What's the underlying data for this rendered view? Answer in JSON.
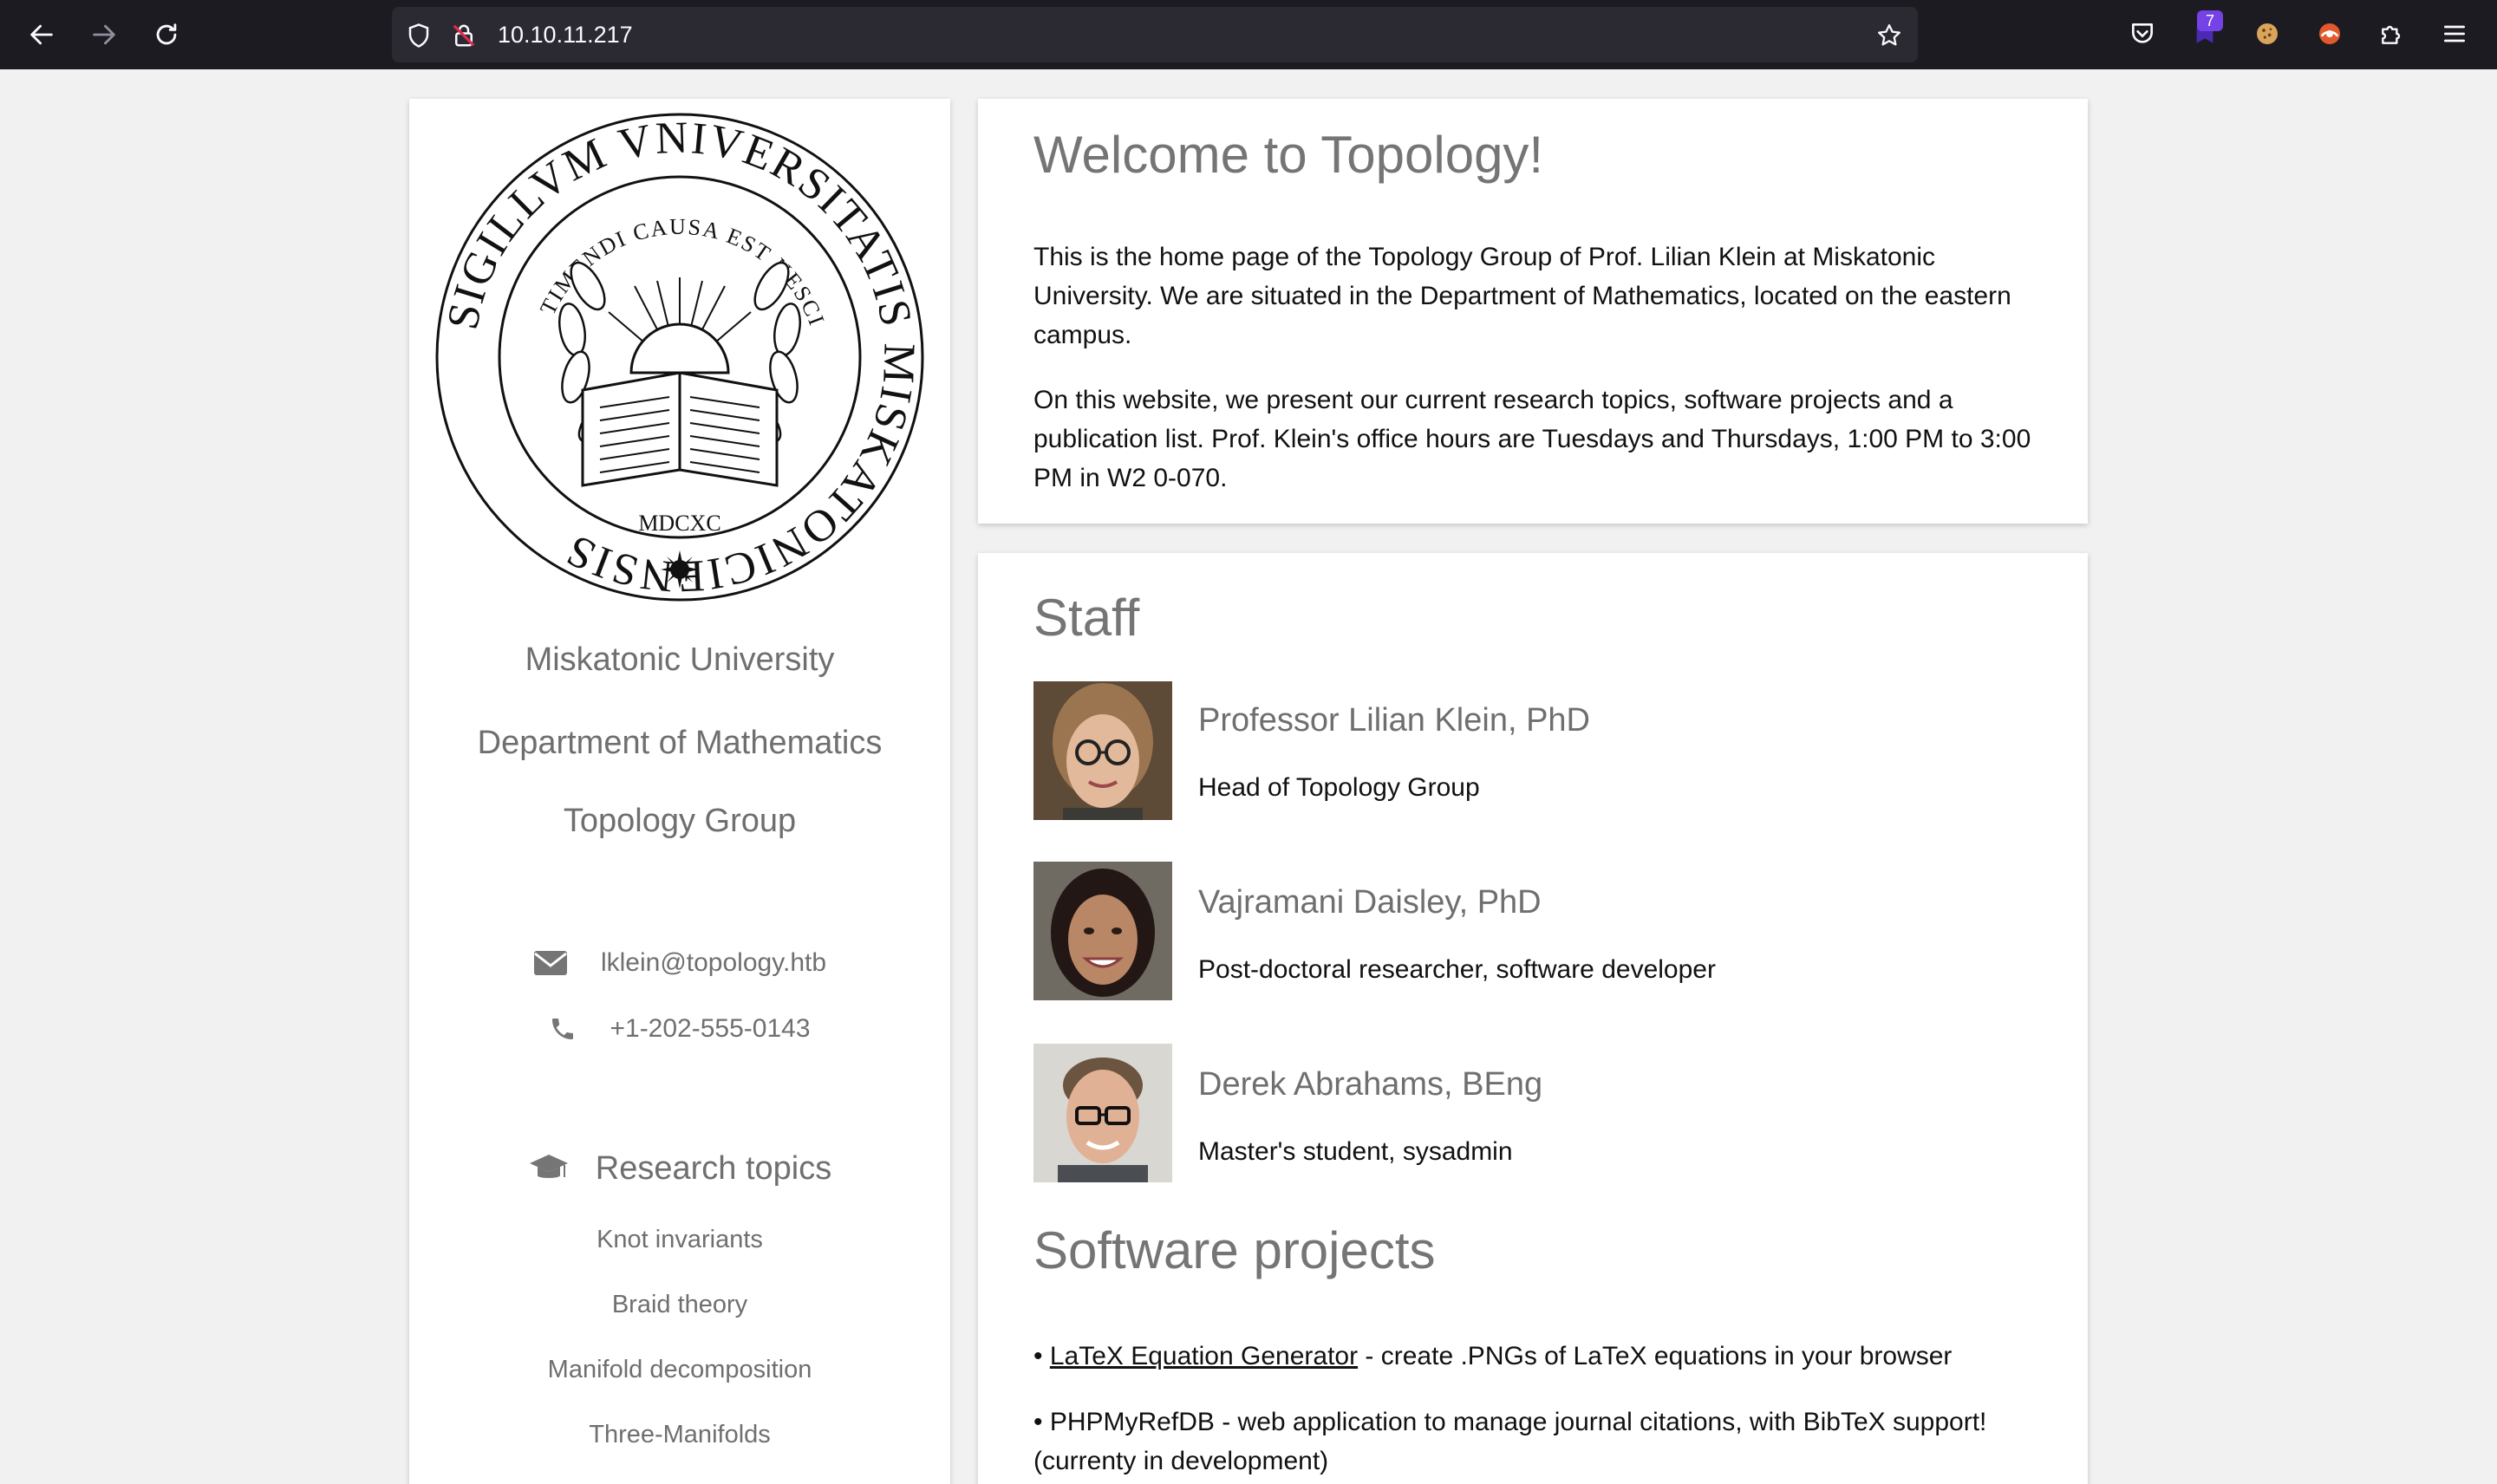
{
  "browser": {
    "url": "10.10.11.217",
    "extension_badge": "7"
  },
  "sidebar": {
    "seal_text_outer": "SIGILLVM VNIVERSITATIS MISKATONICIENSIS",
    "seal_text_inner": "TIMENDI CAUSA EST NESCIRE",
    "seal_year": "MDCXC",
    "university": "Miskatonic University",
    "department": "Department of Mathematics",
    "group": "Topology Group",
    "email": "lklein@topology.htb",
    "phone": "+1-202-555-0143",
    "research_heading": "Research topics",
    "research_topics": [
      "Knot invariants",
      "Braid theory",
      "Manifold decomposition",
      "Three-Manifolds"
    ]
  },
  "welcome": {
    "title": "Welcome to Topology!",
    "paragraph1_lines": [
      "This is the home page of the Topology Group of Prof. Lilian Klein at Miskatonic",
      "University. We are situated in the Department of Mathematics, located on the eastern",
      "campus."
    ],
    "paragraph2_lines": [
      "On this website, we present our current research topics, software projects and a",
      "publication list. Prof. Klein's office hours are Tuesdays and Thursdays, 1:00 PM to 3:00",
      "PM in W2 0-070."
    ]
  },
  "staff": {
    "title": "Staff",
    "members": [
      {
        "name": "Professor Lilian Klein, PhD",
        "role": "Head of Topology Group"
      },
      {
        "name": "Vajramani Daisley, PhD",
        "role": "Post-doctoral researcher, software developer"
      },
      {
        "name": "Derek Abrahams, BEng",
        "role": "Master's student, sysadmin"
      }
    ]
  },
  "software": {
    "title": "Software projects",
    "project1_link": "LaTeX Equation Generator",
    "project1_desc": " - create .PNGs of LaTeX equations in your browser",
    "project2_line1": "• PHPMyRefDB - web application to manage journal citations, with BibTeX support!",
    "project2_line2": "(currenty in development)"
  },
  "colors": {
    "chrome_bg": "#1c1b22",
    "urlbar_bg": "#2b2a33",
    "page_bg": "#f1f1f1",
    "heading_gray": "#757575",
    "badge_purple": "#7542e5"
  }
}
